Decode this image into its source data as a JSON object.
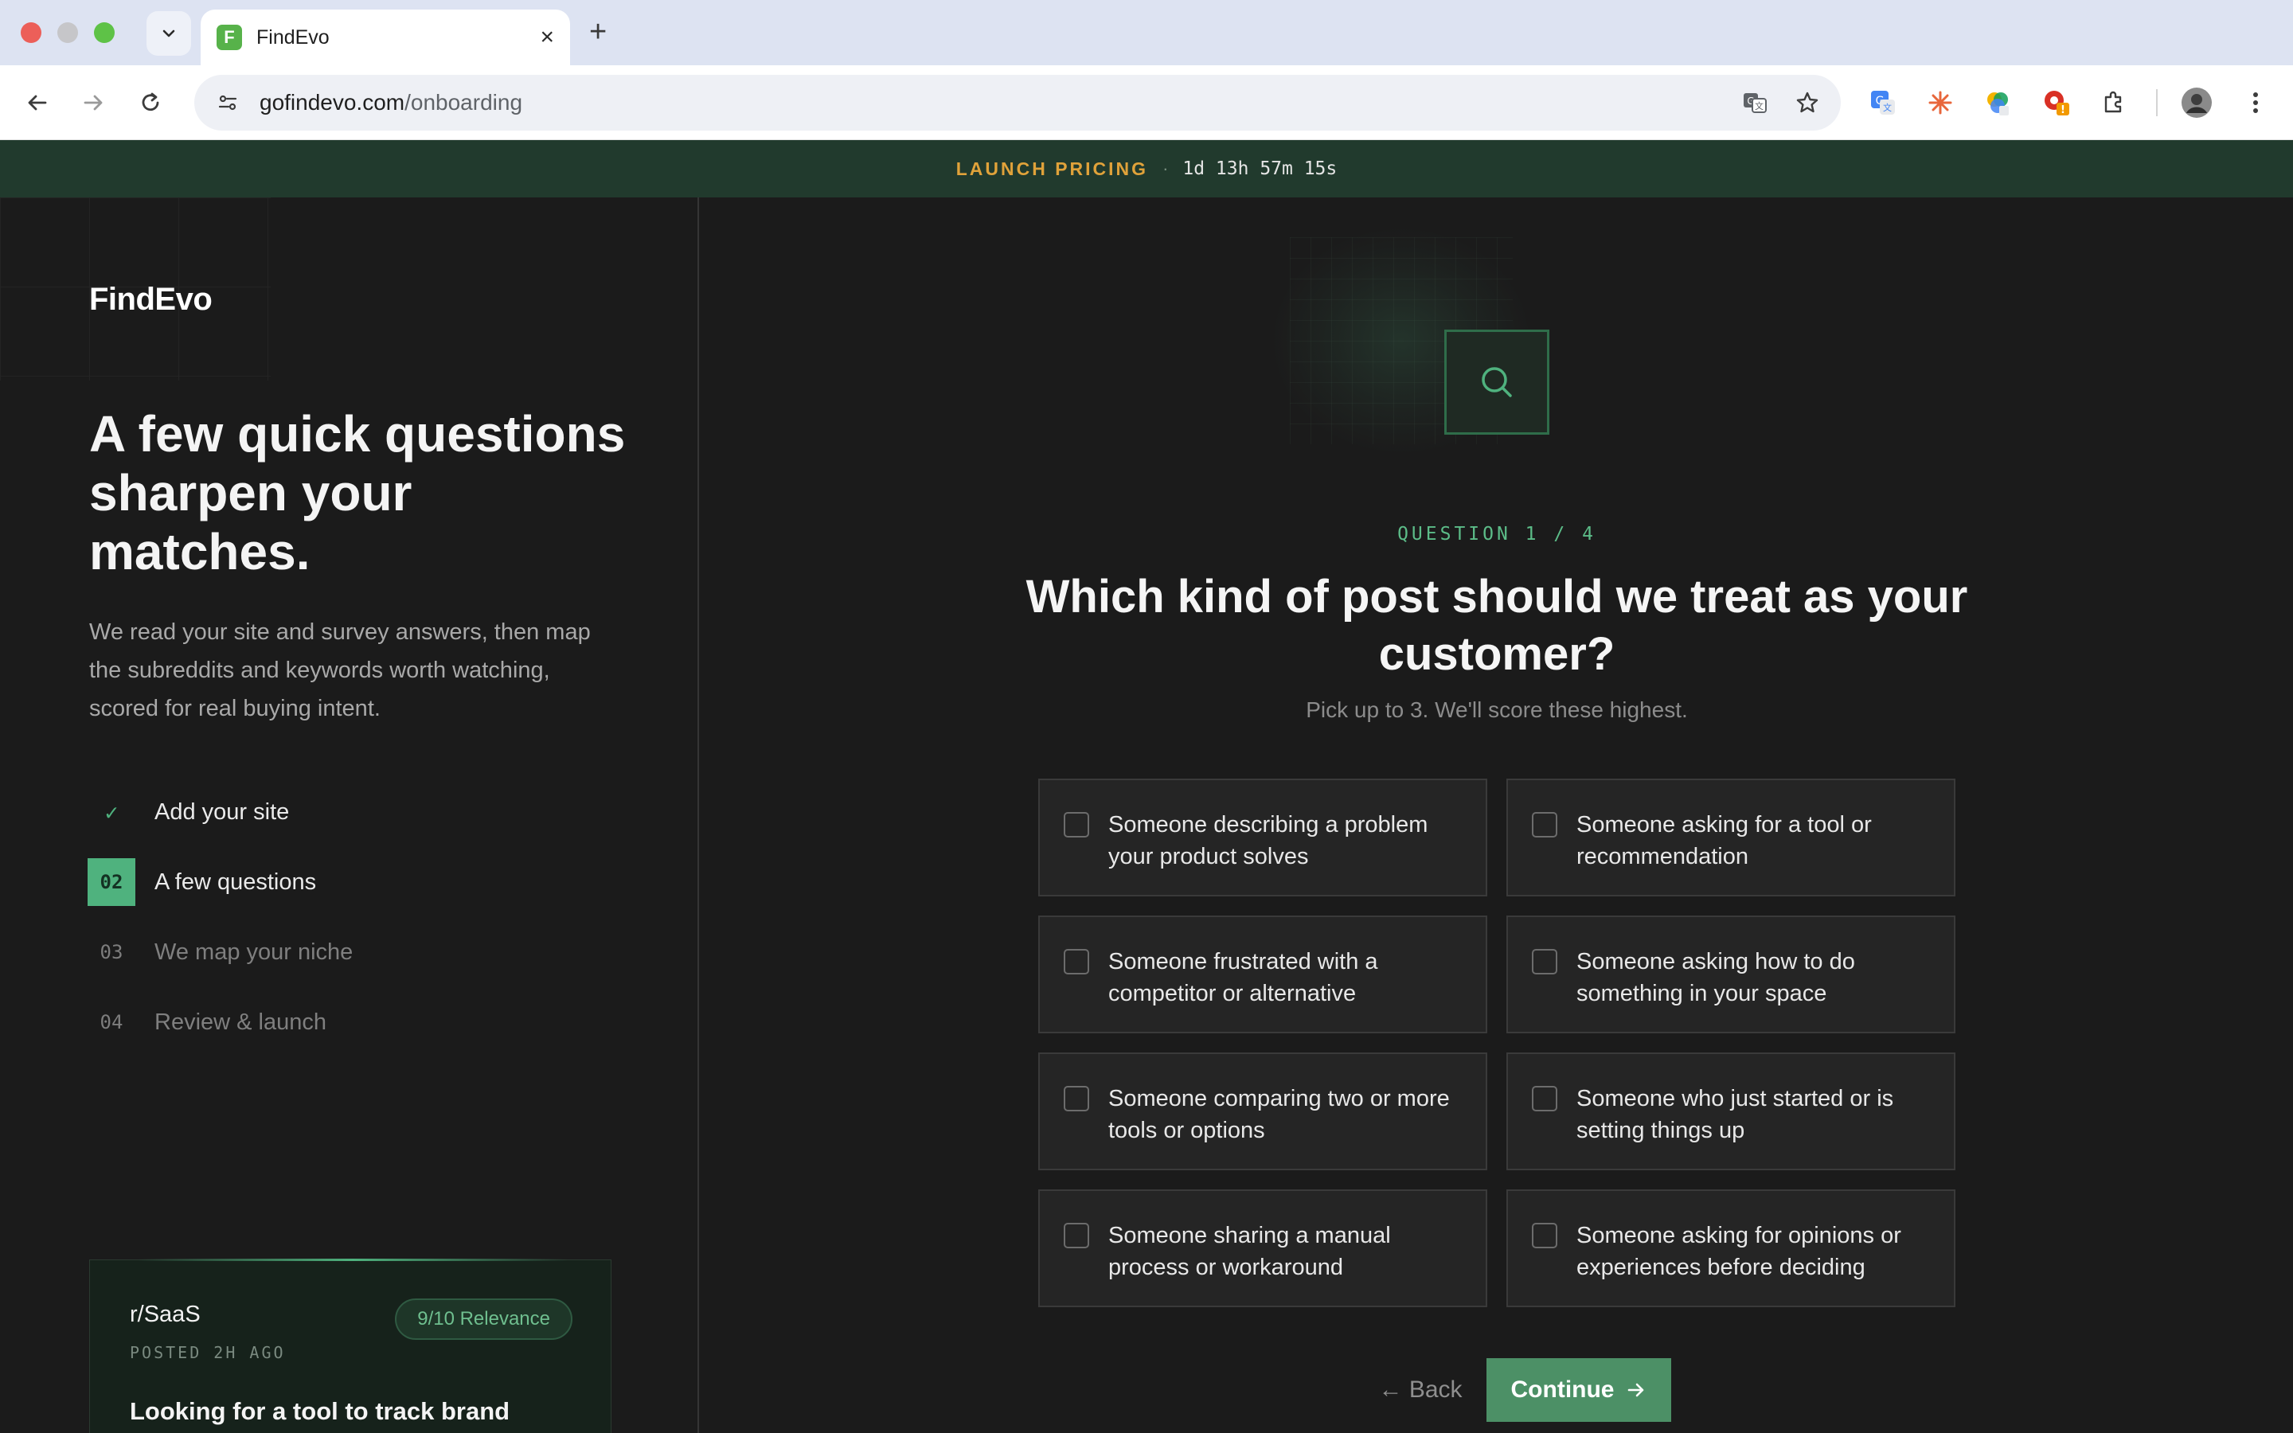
{
  "browser": {
    "tab_title": "FindEvo",
    "favicon_letter": "F",
    "url_host": "gofindevo.com",
    "url_path": "/onboarding",
    "icons": [
      "back-icon",
      "forward-icon",
      "reload-icon",
      "site-info-icon",
      "translate-icon",
      "star-icon",
      "extensions-icon",
      "profile-avatar",
      "menu-icon"
    ]
  },
  "promo": {
    "label": "LAUNCH PRICING",
    "separator": "·",
    "timer": "1d 13h 57m 15s"
  },
  "sidebar": {
    "logo": "FindEvo",
    "headline": "A few quick questions sharpen your matches.",
    "description": "We read your site and survey answers, then map the subreddits and keywords worth watching, scored for real buying intent.",
    "steps": [
      {
        "badge": "✓",
        "label": "Add your site",
        "state": "done"
      },
      {
        "badge": "02",
        "label": "A few questions",
        "state": "active"
      },
      {
        "badge": "03",
        "label": "We map your niche",
        "state": "pending"
      },
      {
        "badge": "04",
        "label": "Review & launch",
        "state": "pending"
      }
    ],
    "preview": {
      "subreddit": "r/SaaS",
      "posted": "POSTED 2H AGO",
      "relevance": "9/10 Relevance",
      "title": "Looking for a tool to track brand"
    }
  },
  "main": {
    "counter": "QUESTION 1 / 4",
    "question": "Which kind of post should we treat as your customer?",
    "hint": "Pick up to 3. We'll score these highest.",
    "options": [
      {
        "label": "Someone describing a problem your product solves",
        "checked": false
      },
      {
        "label": "Someone asking for a tool or recommendation",
        "checked": false
      },
      {
        "label": "Someone frustrated with a competitor or alternative",
        "checked": false
      },
      {
        "label": "Someone asking how to do something in your space",
        "checked": false
      },
      {
        "label": "Someone comparing two or more tools or options",
        "checked": false
      },
      {
        "label": "Someone who just started or is setting things up",
        "checked": false
      },
      {
        "label": "Someone sharing a manual process or workaround",
        "checked": false
      },
      {
        "label": "Someone asking for opinions or experiences before deciding",
        "checked": false
      }
    ],
    "back_label": "← Back",
    "continue_label": "Continue"
  },
  "colors": {
    "accent": "#4fb27e",
    "promo_bg": "#213a2d",
    "promo_label": "#e0a23a",
    "panel_bg": "#1b1b1b",
    "option_bg": "#252525"
  }
}
